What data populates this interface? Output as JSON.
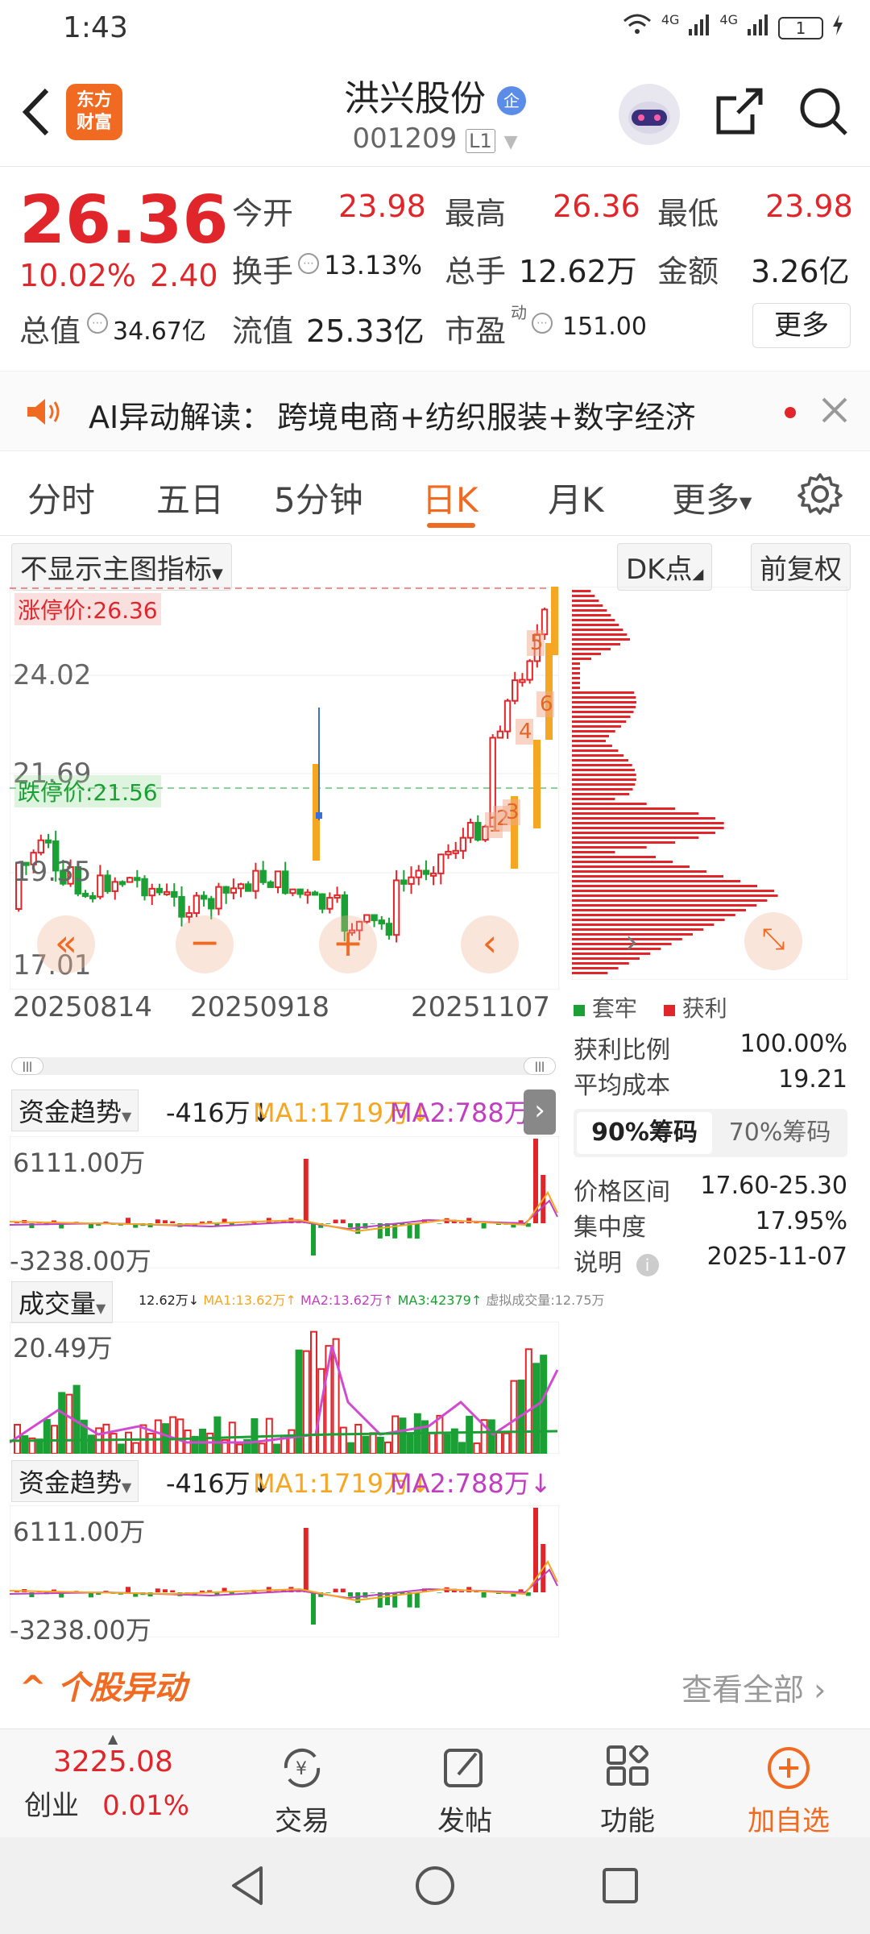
{
  "status": {
    "time": "1:43",
    "signal1": "4G",
    "signal2": "4G",
    "battery": "1"
  },
  "header": {
    "title": "洪兴股份",
    "badge": "企",
    "code": "001209",
    "level": "L1",
    "logo_line1": "东方",
    "logo_line2": "财富"
  },
  "quote": {
    "price": "26.36",
    "change_pct": "10.02%",
    "change": "2.40",
    "open_label": "今开",
    "open": "23.98",
    "high_label": "最高",
    "high": "26.36",
    "low_label": "最低",
    "low": "23.98",
    "turnover_label": "换手",
    "turnover": "13.13%",
    "volume_label": "总手",
    "volume": "12.62万",
    "amount_label": "金额",
    "amount": "3.26亿",
    "mcap_label": "总值",
    "mcap": "34.67亿",
    "float_label": "流值",
    "float": "25.33亿",
    "pe_label": "市盈",
    "pe_sup": "动",
    "pe": "151.00",
    "more": "更多"
  },
  "ai": {
    "label": "AI异动解读：",
    "text": "跨境电商+纺织服装+数字经济"
  },
  "tabs": [
    "分时",
    "五日",
    "5分钟",
    "日K",
    "月K",
    "更多"
  ],
  "active_tab": "日K",
  "chart_controls": {
    "indicator": "不显示主图指标",
    "dk": "DK点",
    "adjust": "前复权"
  },
  "kline": {
    "limit_up_label": "涨停价:26.36",
    "limit_down_label": "跌停价:21.56",
    "y_ticks": [
      "26.36",
      "24.02",
      "21.69",
      "19.35",
      "17.01"
    ],
    "x_ticks": [
      "20250814",
      "20250918",
      "20251107"
    ],
    "markers": [
      "1",
      "2",
      "3",
      "4",
      "5",
      "6"
    ]
  },
  "chips": {
    "legend_trap": "套牢",
    "legend_profit": "获利",
    "rows": [
      {
        "label": "获利比例",
        "value": "100.00%"
      },
      {
        "label": "平均成本",
        "value": "19.21"
      }
    ],
    "tab90": "90%筹码",
    "tab70": "70%筹码",
    "rows2": [
      {
        "label": "价格区间",
        "value": "17.60-25.30"
      },
      {
        "label": "集中度",
        "value": "17.95%"
      },
      {
        "label": "说明",
        "value": "2025-11-07"
      }
    ]
  },
  "funds1": {
    "label": "资金趋势",
    "value": "-416万↓",
    "ma1": "MA1:1719万↓",
    "ma2": "MA2:788万↓",
    "top": "6111.00万",
    "bottom": "-3238.00万"
  },
  "volume": {
    "label": "成交量",
    "value": "12.62万↓",
    "ma1": "MA1:13.62万↑",
    "ma2": "MA2:13.62万↑",
    "ma3": "MA3:42379↑",
    "virtual": "虚拟成交量:12.75万",
    "top": "20.49万"
  },
  "funds2": {
    "label": "资金趋势",
    "value": "-416万↓",
    "ma1": "MA1:1719万↓",
    "ma2": "MA2:788万↓",
    "top": "6111.00万",
    "bottom": "-3238.00万"
  },
  "news": {
    "title": "个股异动",
    "view_all": "查看全部"
  },
  "nav": {
    "index_value": "3225.08",
    "index_name": "创业",
    "index_change": "0.01%",
    "trade": "交易",
    "post": "发帖",
    "func": "功能",
    "add": "加自选"
  },
  "colors": {
    "up": "#e0262a",
    "down": "#1aa034",
    "limit": "#f5a623",
    "accent": "#f06a21"
  }
}
